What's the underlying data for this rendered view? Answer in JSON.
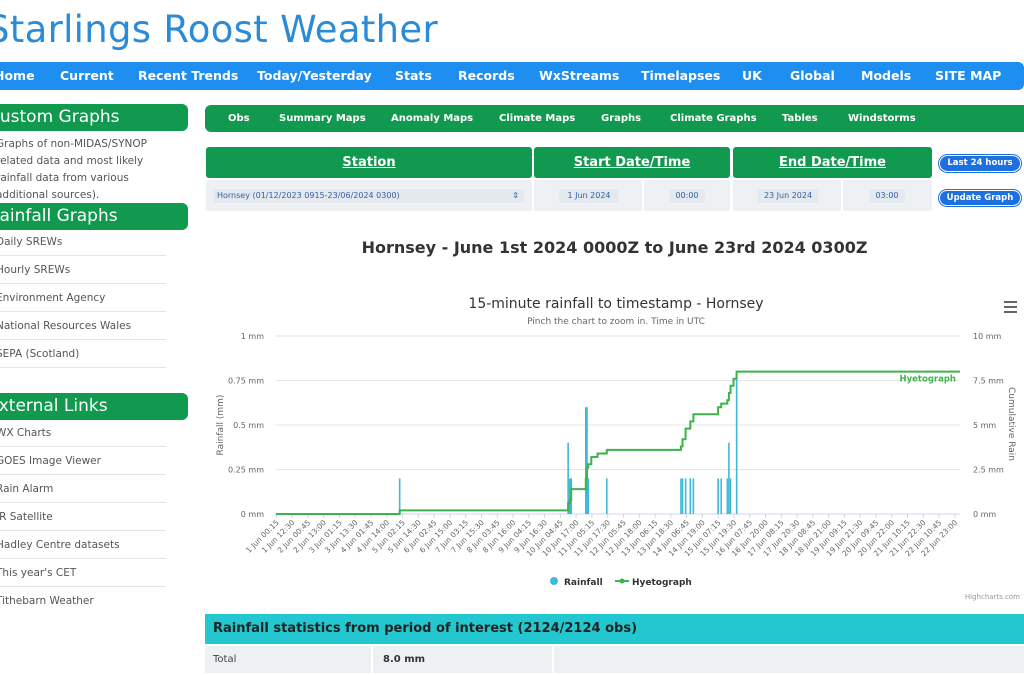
{
  "site": {
    "title": "Starlings Roost Weather"
  },
  "nav": [
    "Home",
    "Current",
    "Recent Trends",
    "Today/Yesterday",
    "Stats",
    "Records",
    "WxStreams",
    "Timelapses",
    "UK",
    "Global",
    "Models",
    "SITE MAP"
  ],
  "sidebar": {
    "custom": {
      "title": "Custom Graphs",
      "text": "Graphs of non-MIDAS/SYNOP related data and most likely rainfall data from various additional sources)."
    },
    "rainfall": {
      "title": "Rainfall Graphs",
      "items": [
        "Daily SREWs",
        "Hourly SREWs",
        "Environment Agency",
        "National Resources Wales",
        "SEPA (Scotland)"
      ]
    },
    "external": {
      "title": "External Links",
      "items": [
        "WX Charts",
        "GOES Image Viewer",
        "Rain Alarm",
        "IR Satellite",
        "Hadley Centre datasets",
        "This year's CET",
        "Tithebarn Weather"
      ]
    }
  },
  "subnav": [
    "Obs",
    "Summary Maps",
    "Anomaly Maps",
    "Climate Maps",
    "Graphs",
    "Climate Graphs",
    "Tables",
    "Windstorms"
  ],
  "form": {
    "station_header": "Station",
    "start_header": "Start Date/Time",
    "end_header": "End Date/Time",
    "last24_label": "Last 24 hours",
    "station_value": "Hornsey (01/12/2023 0915-23/06/2024 0300)",
    "start_date": "1 Jun 2024",
    "start_time": "00:00",
    "end_date": "23 Jun 2024",
    "end_time": "03:00",
    "update_label": "Update Graph"
  },
  "heading": "Hornsey - June 1st 2024 0000Z to June 23rd 2024 0300Z",
  "chart_data": {
    "type": "bar",
    "title": "15-minute rainfall to timestamp - Hornsey",
    "subtitle": "Pinch the chart to zoom in. Time in UTC",
    "ylabel": "Rainfall (mm)",
    "y2label": "Cumulative Rain",
    "ylim": [
      0,
      1
    ],
    "y2lim": [
      0,
      10
    ],
    "yticks": [
      "0 mm",
      "0.25 mm",
      "0.5 mm",
      "0.75 mm",
      "1 mm"
    ],
    "y2ticks": [
      "0 mm",
      "2.5 mm",
      "5 mm",
      "7.5 mm",
      "10 mm"
    ],
    "xticks": [
      "1 Jun 00:15",
      "1 Jun 12:30",
      "2 Jun 00:45",
      "2 Jun 13:00",
      "3 Jun 01:15",
      "3 Jun 13:30",
      "4 Jun 01:45",
      "4 Jun 14:00",
      "5 Jun 02:15",
      "5 Jun 14:30",
      "6 Jun 02:45",
      "6 Jun 15:00",
      "7 Jun 03:15",
      "7 Jun 15:30",
      "8 Jun 03:45",
      "8 Jun 16:00",
      "9 Jun 04:15",
      "9 Jun 16:30",
      "10 Jun 04:45",
      "10 Jun 17:00",
      "11 Jun 05:15",
      "11 Jun 17:30",
      "12 Jun 05:45",
      "12 Jun 18:00",
      "13 Jun 06:15",
      "13 Jun 18:30",
      "14 Jun 06:45",
      "14 Jun 19:00",
      "15 Jun 07:15",
      "15 Jun 19:30",
      "16 Jun 07:45",
      "16 Jun 20:00",
      "17 Jun 08:15",
      "17 Jun 20:30",
      "18 Jun 08:45",
      "18 Jun 21:00",
      "19 Jun 09:15",
      "19 Jun 21:30",
      "20 Jun 09:45",
      "20 Jun 22:00",
      "21 Jun 10:15",
      "21 Jun 22:30",
      "22 Jun 10:45",
      "22 Jun 23:00"
    ],
    "x_range_days": [
      1.0,
      23.125
    ],
    "series": [
      {
        "name": "Rainfall",
        "type": "column",
        "color": "#3fb9d9",
        "points": [
          [
            5.0,
            0.2
          ],
          [
            10.45,
            0.4
          ],
          [
            10.5,
            0.2
          ],
          [
            10.55,
            0.2
          ],
          [
            11.02,
            0.6
          ],
          [
            11.06,
            0.6
          ],
          [
            11.1,
            0.2
          ],
          [
            11.7,
            0.2
          ],
          [
            14.1,
            0.2
          ],
          [
            14.15,
            0.2
          ],
          [
            14.25,
            0.2
          ],
          [
            14.4,
            0.2
          ],
          [
            14.5,
            0.2
          ],
          [
            15.3,
            0.2
          ],
          [
            15.4,
            0.2
          ],
          [
            15.6,
            0.2
          ],
          [
            15.65,
            0.4
          ],
          [
            15.7,
            0.2
          ],
          [
            15.9,
            0.8
          ]
        ]
      },
      {
        "name": "Hyetograph",
        "type": "line",
        "color": "#3cb44b",
        "label": "Hyetograph",
        "points": [
          [
            1.0,
            0
          ],
          [
            5.0,
            0
          ],
          [
            5.0,
            0.2
          ],
          [
            10.45,
            0.2
          ],
          [
            10.45,
            0.6
          ],
          [
            10.5,
            0.6
          ],
          [
            10.5,
            0.8
          ],
          [
            10.55,
            0.8
          ],
          [
            10.55,
            1.4
          ],
          [
            11.02,
            1.4
          ],
          [
            11.02,
            2.0
          ],
          [
            11.06,
            2.0
          ],
          [
            11.06,
            2.6
          ],
          [
            11.1,
            2.6
          ],
          [
            11.1,
            2.8
          ],
          [
            11.2,
            2.8
          ],
          [
            11.2,
            3.2
          ],
          [
            11.4,
            3.2
          ],
          [
            11.4,
            3.4
          ],
          [
            11.7,
            3.4
          ],
          [
            11.7,
            3.6
          ],
          [
            14.1,
            3.6
          ],
          [
            14.1,
            3.8
          ],
          [
            14.15,
            3.8
          ],
          [
            14.15,
            4.2
          ],
          [
            14.25,
            4.2
          ],
          [
            14.25,
            4.8
          ],
          [
            14.4,
            4.8
          ],
          [
            14.4,
            5.2
          ],
          [
            14.5,
            5.2
          ],
          [
            14.5,
            5.6
          ],
          [
            15.3,
            5.6
          ],
          [
            15.3,
            6.0
          ],
          [
            15.4,
            6.0
          ],
          [
            15.4,
            6.2
          ],
          [
            15.6,
            6.2
          ],
          [
            15.6,
            6.4
          ],
          [
            15.65,
            6.4
          ],
          [
            15.65,
            6.8
          ],
          [
            15.7,
            6.8
          ],
          [
            15.7,
            7.2
          ],
          [
            15.8,
            7.2
          ],
          [
            15.8,
            7.6
          ],
          [
            15.9,
            7.6
          ],
          [
            15.9,
            8.0
          ],
          [
            23.125,
            8.0
          ]
        ]
      }
    ],
    "legend": [
      "Rainfall",
      "Hyetograph"
    ],
    "legend_position": "bottom",
    "credit": "Highcharts.com",
    "grid": true
  },
  "stats": {
    "title": "Rainfall statistics from period of interest (2124/2124 obs)",
    "rows": [
      {
        "label": "Total",
        "value": "8.0 mm"
      }
    ]
  }
}
